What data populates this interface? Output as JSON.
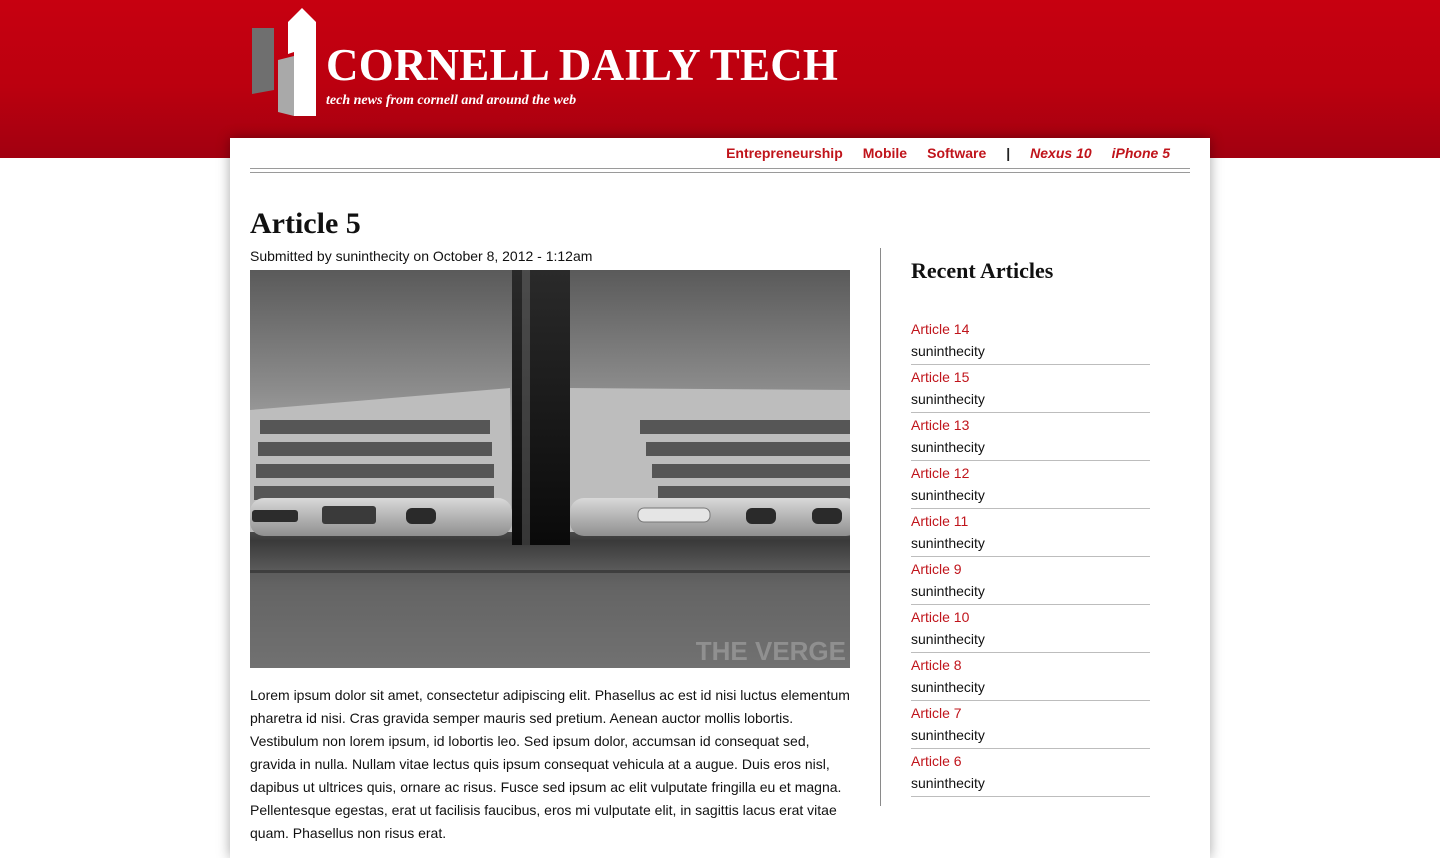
{
  "header": {
    "site_title": "CORNELL DAILY TECH",
    "tagline": "tech news from cornell and around the web",
    "brand_color": "#c0000f"
  },
  "nav": {
    "items": [
      {
        "label": "Entrepreneurship"
      },
      {
        "label": "Mobile"
      },
      {
        "label": "Software"
      }
    ],
    "separator": "|",
    "featured": [
      {
        "label": "Nexus 10"
      },
      {
        "label": "iPhone 5"
      }
    ]
  },
  "article": {
    "title": "Article 5",
    "submitted": "Submitted by suninthecity on October 8, 2012 - 1:12am",
    "image_watermark": "THE VERGE",
    "body": "Lorem ipsum dolor sit amet, consectetur adipiscing elit. Phasellus ac est id nisi luctus elementum pharetra id nisi. Cras gravida semper mauris sed pretium. Aenean auctor mollis lobortis. Vestibulum non lorem ipsum, id lobortis leo. Sed ipsum dolor, accumsan id consequat sed, gravida in nulla. Nullam vitae lectus quis ipsum consequat vehicula at a augue. Duis eros nisl, dapibus ut ultrices quis, ornare ac risus. Fusce sed ipsum ac elit vulputate fringilla eu et magna. Pellentesque egestas, erat ut facilisis faucibus, eros mi vulputate elit, in sagittis lacus erat vitae quam. Phasellus non risus erat."
  },
  "sidebar": {
    "title": "Recent Articles",
    "items": [
      {
        "title": "Article 14",
        "author": "suninthecity"
      },
      {
        "title": "Article 15",
        "author": "suninthecity"
      },
      {
        "title": "Article 13",
        "author": "suninthecity"
      },
      {
        "title": "Article 12",
        "author": "suninthecity"
      },
      {
        "title": "Article 11",
        "author": "suninthecity"
      },
      {
        "title": "Article 9",
        "author": "suninthecity"
      },
      {
        "title": "Article 10",
        "author": "suninthecity"
      },
      {
        "title": "Article 8",
        "author": "suninthecity"
      },
      {
        "title": "Article 7",
        "author": "suninthecity"
      },
      {
        "title": "Article 6",
        "author": "suninthecity"
      }
    ]
  }
}
